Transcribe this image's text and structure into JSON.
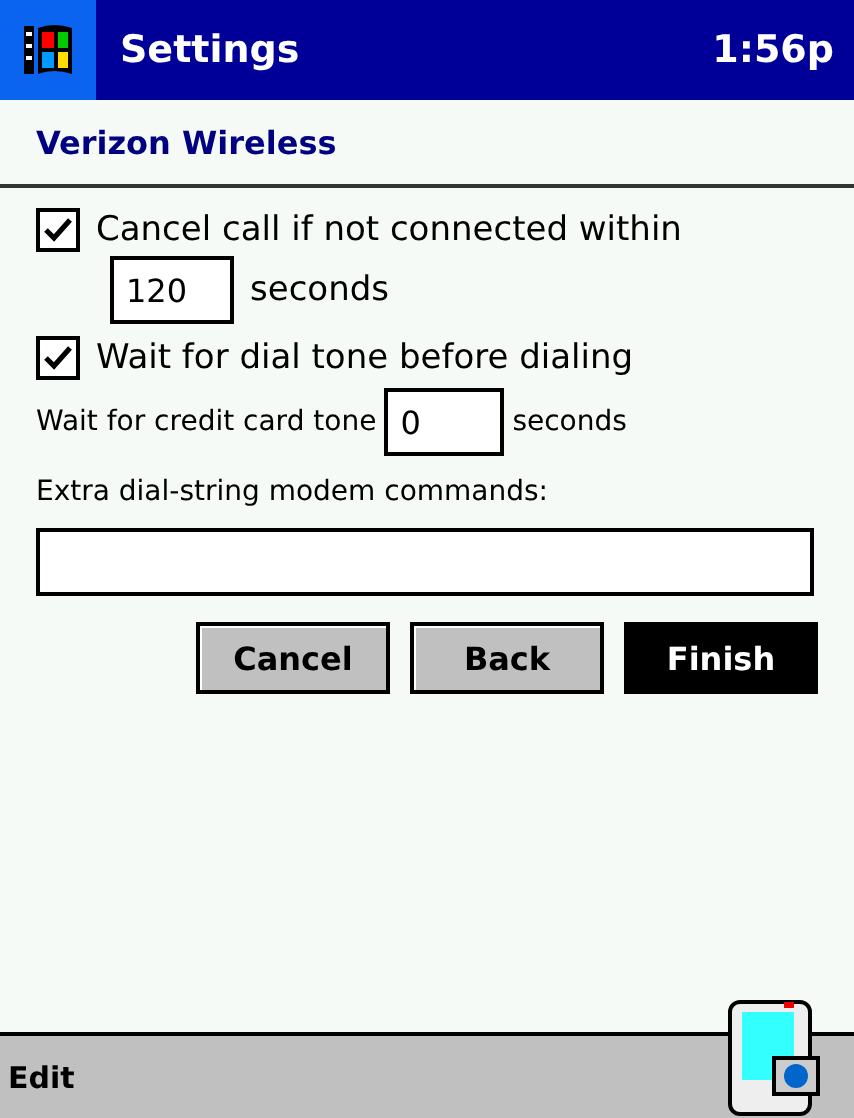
{
  "title_bar": {
    "title": "Settings",
    "time": "1:56p"
  },
  "header": {
    "title": "Verizon Wireless"
  },
  "cancel_option": {
    "label": "Cancel call if not connected within",
    "checked": true,
    "value": "120",
    "unit": "seconds"
  },
  "dial_tone_option": {
    "label": "Wait for dial tone before dialing",
    "checked": true
  },
  "credit_card": {
    "label": "Wait for credit card tone",
    "value": "0",
    "unit": "seconds"
  },
  "extra_commands": {
    "label": "Extra dial-string modem commands:"
  },
  "buttons": [
    {
      "label": "Cancel",
      "kind": "normal"
    },
    {
      "label": "Back",
      "kind": "normal"
    },
    {
      "label": "Finish",
      "kind": "default"
    }
  ],
  "menu_bar": {
    "items": [
      "Edit"
    ]
  }
}
